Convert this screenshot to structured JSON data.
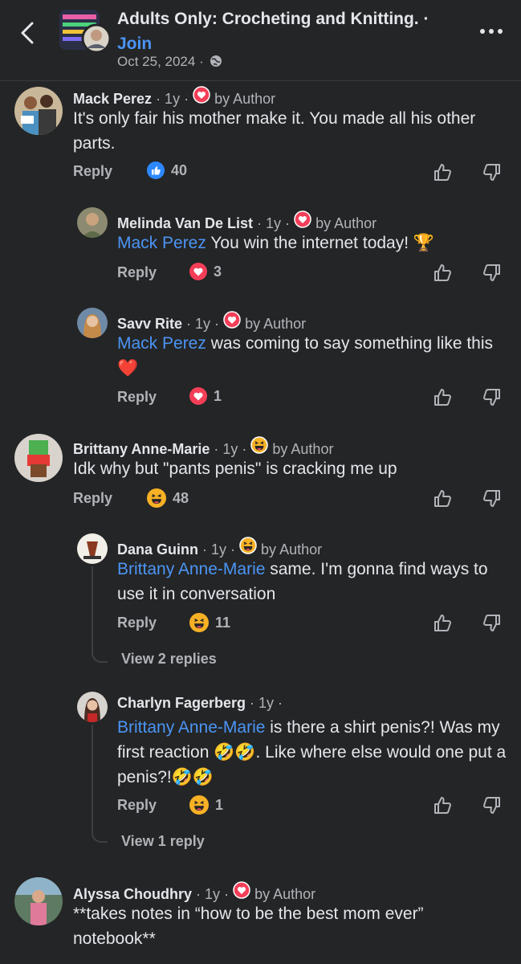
{
  "header": {
    "group_name": "Adults Only: Crocheting and Knitting.",
    "separator": " · ",
    "join_label": "Join",
    "date": "Oct 25, 2024 ·"
  },
  "comments": [
    {
      "name": "Mack Perez",
      "meta": " · 1y · ",
      "author_label": "by Author",
      "text": "It's only fair his mother make it. You made all his other parts.",
      "reply": "Reply",
      "count": "40"
    },
    {
      "name": "Melinda Van De List",
      "meta": " · 1y · ",
      "author_label": "by Author",
      "mention": "Mack Perez",
      "text": " You win the internet today! 🏆",
      "reply": "Reply",
      "count": "3"
    },
    {
      "name": "Savv Rite",
      "meta": " · 1y · ",
      "author_label": "by Author",
      "mention": "Mack Perez",
      "text": " was coming to say something like this ❤️",
      "reply": "Reply",
      "count": "1"
    },
    {
      "name": "Brittany Anne-Marie",
      "meta": " · 1y · ",
      "author_label": "by Author",
      "text": "Idk why but \"pants penis\" is cracking me up",
      "reply": "Reply",
      "count": "48"
    },
    {
      "name": "Dana Guinn",
      "meta": " · 1y · ",
      "author_label": "by Author",
      "mention": "Brittany Anne-Marie",
      "text": " same.  I'm gonna find ways to use it in conversation",
      "reply": "Reply",
      "count": "11",
      "view_replies": "View 2 replies"
    },
    {
      "name": "Charlyn Fagerberg",
      "meta": " · 1y ·",
      "mention": "Brittany Anne-Marie",
      "text": " is there a shirt penis?! Was my first reaction 🤣🤣. Like where else would one put a penis?!🤣🤣",
      "reply": "Reply",
      "count": "1",
      "view_replies": "View 1 reply"
    },
    {
      "name": "Alyssa Choudhry",
      "meta": " · 1y · ",
      "author_label": "by Author",
      "text": "**takes notes in “how to be the best mom ever” notebook**"
    }
  ],
  "colors": {
    "background": "#242526",
    "link": "#4b95f5",
    "secondary": "#b0b3b8",
    "like_blue": "#2d88ff",
    "love_red": "#f33e58"
  }
}
